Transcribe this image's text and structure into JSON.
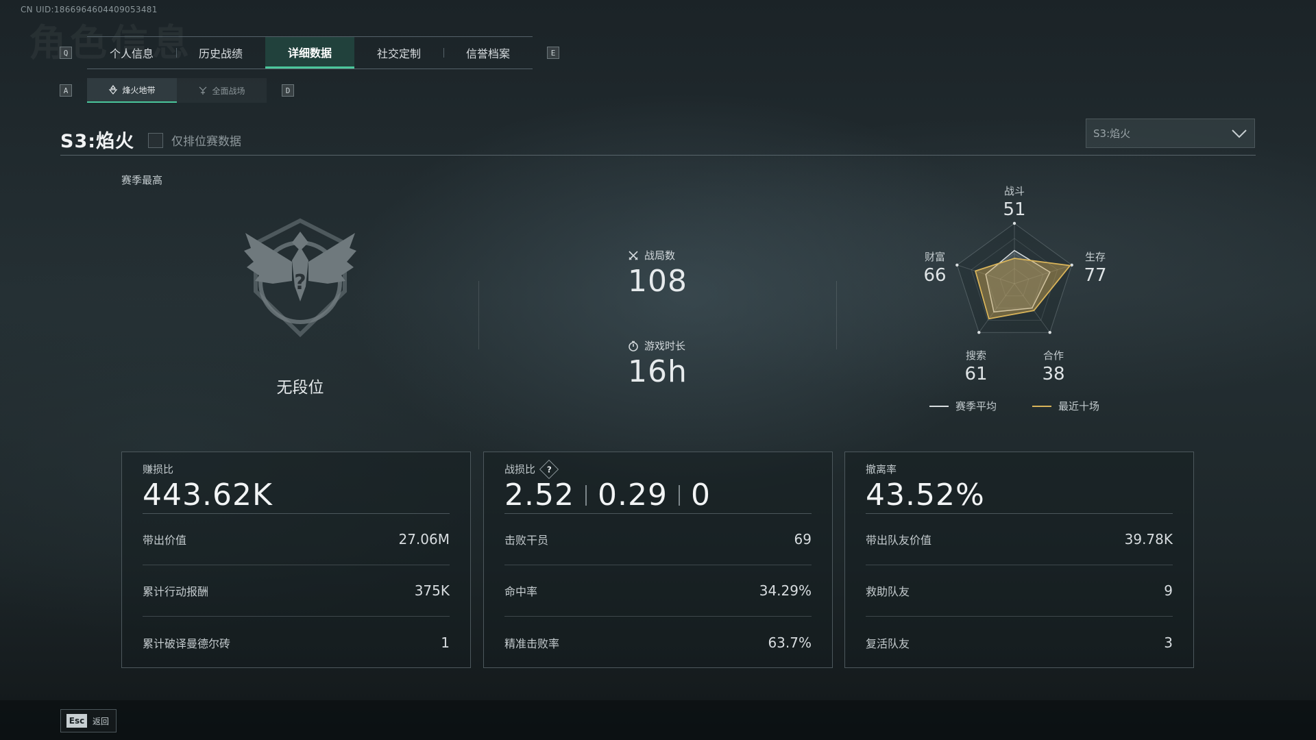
{
  "uid": "CN UID:1866964604409053481",
  "bg_title": "角色信息",
  "tab_keys": {
    "prev": "Q",
    "next": "E"
  },
  "tabs": [
    {
      "label": "个人信息"
    },
    {
      "label": "历史战绩"
    },
    {
      "label": "详细数据",
      "active": true
    },
    {
      "label": "社交定制"
    },
    {
      "label": "信誉档案"
    }
  ],
  "subtab_keys": {
    "prev": "A",
    "next": "D"
  },
  "subtabs": [
    {
      "label": "烽火地带",
      "icon": "fire-zone-icon",
      "active": true
    },
    {
      "label": "全面战场",
      "icon": "battlefield-icon"
    }
  ],
  "season": {
    "title": "S3:焰火",
    "rank_only_label": "仅排位赛数据",
    "rank_only_checked": false,
    "select_value": "S3:焰火"
  },
  "best": {
    "label": "赛季最高",
    "rank_name": "无段位"
  },
  "matches": {
    "label": "战局数",
    "value": "108"
  },
  "playtime": {
    "label": "游戏时长",
    "value": "16h"
  },
  "radar": {
    "axes": [
      {
        "label": "战斗",
        "value": "51"
      },
      {
        "label": "生存",
        "value": "77"
      },
      {
        "label": "合作",
        "value": "38"
      },
      {
        "label": "搜索",
        "value": "61"
      },
      {
        "label": "财富",
        "value": "66"
      }
    ],
    "recent_ten": [
      0.42,
      0.97,
      0.55,
      0.72,
      0.68
    ],
    "season_avg": [
      0.55,
      0.62,
      0.5,
      0.58,
      0.5
    ],
    "legend": {
      "season_avg": "赛季平均",
      "recent_ten": "最近十场"
    },
    "colors": {
      "season_avg": "#d9dee0",
      "recent_ten": "#d9b45a"
    }
  },
  "cards": {
    "profit": {
      "label": "赚损比",
      "value": "443.62K",
      "rows": [
        {
          "k": "带出价值",
          "v": "27.06M"
        },
        {
          "k": "累计行动报酬",
          "v": "375K"
        },
        {
          "k": "累计破译曼德尔砖",
          "v": "1"
        }
      ]
    },
    "kd": {
      "label": "战损比",
      "help": "?",
      "values": [
        "2.52",
        "0.29",
        "0"
      ],
      "rows": [
        {
          "k": "击败干员",
          "v": "69"
        },
        {
          "k": "命中率",
          "v": "34.29%"
        },
        {
          "k": "精准击败率",
          "v": "63.7%"
        }
      ]
    },
    "extract": {
      "label": "撤离率",
      "value": "43.52%",
      "rows": [
        {
          "k": "带出队友价值",
          "v": "39.78K"
        },
        {
          "k": "救助队友",
          "v": "9"
        },
        {
          "k": "复活队友",
          "v": "3"
        }
      ]
    }
  },
  "footer": {
    "key": "Esc",
    "label": "返回"
  },
  "colors": {
    "accent": "#4bc79c",
    "radar_fill": "#c9a552"
  }
}
